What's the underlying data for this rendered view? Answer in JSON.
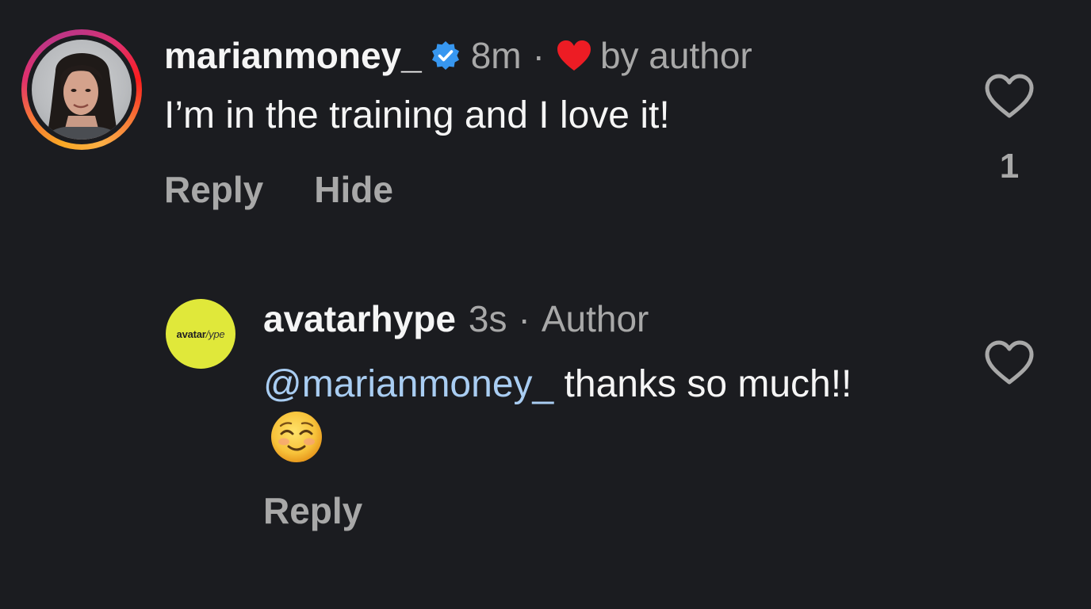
{
  "comments": [
    {
      "username": "marianmoney_",
      "verified": true,
      "time": "8m",
      "separator": "·",
      "liked_by_author_label": "by author",
      "text": "I’m in the training and I love it!",
      "reply_label": "Reply",
      "hide_label": "Hide",
      "like_count": "1"
    },
    {
      "username": "avatarhype",
      "avatar_logo_bold": "avatar",
      "avatar_logo_italic": "/ype",
      "time": "3s",
      "separator": "·",
      "author_label": "Author",
      "mention": "@marianmoney_",
      "text": " thanks so much!!",
      "emoji": "smiling-face-emoji",
      "reply_label": "Reply"
    }
  ],
  "colors": {
    "background": "#1b1c20",
    "primary_text": "#f5f5f5",
    "secondary_text": "#a8a8a8",
    "mention": "#a9cdf2",
    "verified_badge": "#3797f0",
    "author_heart": "#ed1c24",
    "reply_avatar_bg": "#e0e83a"
  }
}
